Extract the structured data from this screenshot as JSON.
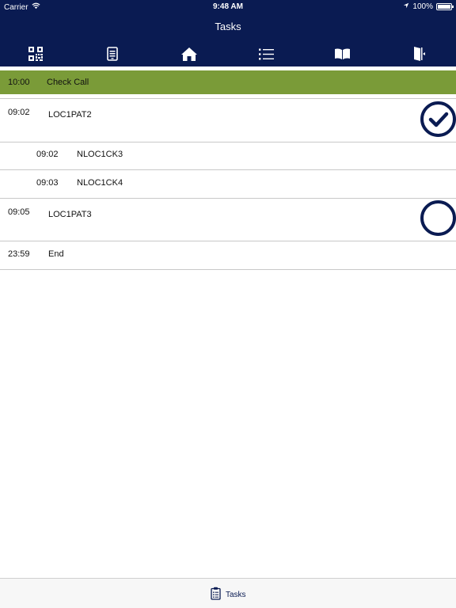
{
  "status_bar": {
    "carrier": "Carrier",
    "time": "9:48 AM",
    "battery": "100%"
  },
  "header": {
    "title": "Tasks"
  },
  "toolbar": {
    "icons": [
      "qr-code-icon",
      "device-icon",
      "home-icon",
      "list-icon",
      "book-icon",
      "exit-door-icon"
    ]
  },
  "banner": {
    "time": "10:00",
    "label": "Check Call",
    "color": "#7a9b38"
  },
  "tasks": [
    {
      "time": "09:02",
      "label": "LOC1PAT2",
      "status": "completed"
    },
    {
      "time": "09:02",
      "label": "NLOC1CK3"
    },
    {
      "time": "09:03",
      "label": "NLOC1CK4"
    },
    {
      "time": "09:05",
      "label": "LOC1PAT3",
      "status": "pending"
    },
    {
      "time": "23:59",
      "label": "End"
    }
  ],
  "tab_bar": {
    "tasks_label": "Tasks"
  },
  "colors": {
    "header": "#0a1b52",
    "accent": "#0a1b52"
  }
}
